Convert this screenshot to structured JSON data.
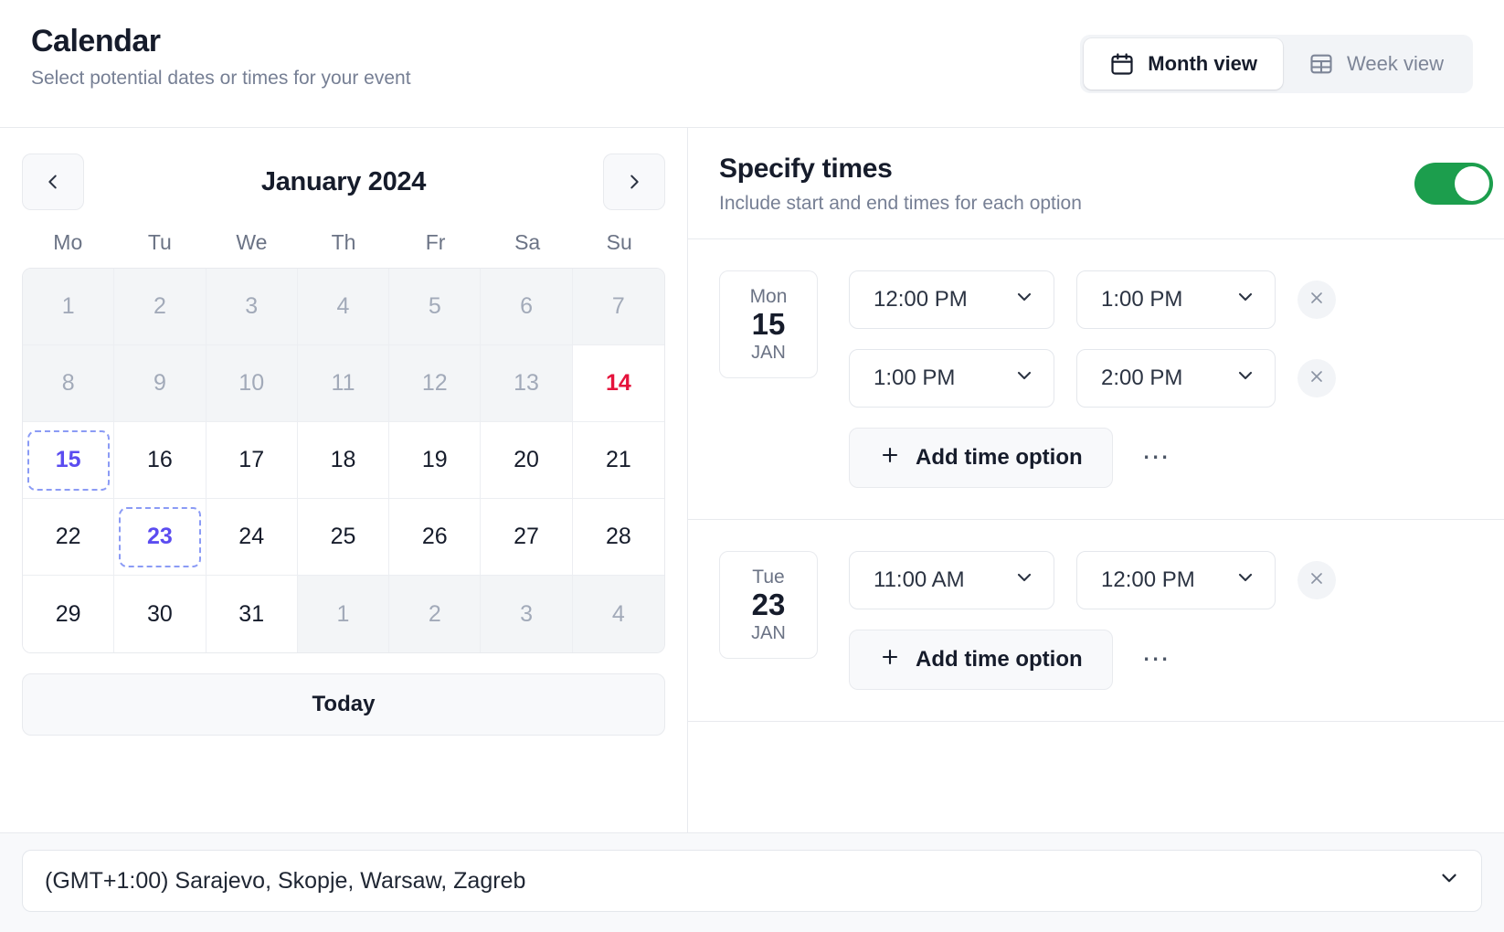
{
  "header": {
    "title": "Calendar",
    "subtitle": "Select potential dates or times for your event",
    "views": [
      {
        "label": "Month view",
        "icon": "calendar-icon",
        "active": true
      },
      {
        "label": "Week view",
        "icon": "table-grid-icon",
        "active": false
      }
    ]
  },
  "calendar": {
    "month_label": "January 2024",
    "prev_icon": "chevron-left-icon",
    "next_icon": "chevron-right-icon",
    "weekdays": [
      "Mo",
      "Tu",
      "We",
      "Th",
      "Fr",
      "Sa",
      "Su"
    ],
    "today_button": "Today",
    "colors": {
      "selected": "#5b4cf0",
      "selected_border": "#8b9bf5",
      "today": "#e5133c",
      "muted": "#a2aab9"
    },
    "weeks": [
      [
        {
          "day": "1",
          "state": "muted"
        },
        {
          "day": "2",
          "state": "muted"
        },
        {
          "day": "3",
          "state": "muted"
        },
        {
          "day": "4",
          "state": "muted"
        },
        {
          "day": "5",
          "state": "muted"
        },
        {
          "day": "6",
          "state": "muted"
        },
        {
          "day": "7",
          "state": "muted"
        }
      ],
      [
        {
          "day": "8",
          "state": "muted"
        },
        {
          "day": "9",
          "state": "muted"
        },
        {
          "day": "10",
          "state": "muted"
        },
        {
          "day": "11",
          "state": "muted"
        },
        {
          "day": "12",
          "state": "muted"
        },
        {
          "day": "13",
          "state": "muted"
        },
        {
          "day": "14",
          "state": "today"
        }
      ],
      [
        {
          "day": "15",
          "state": "selected"
        },
        {
          "day": "16",
          "state": "normal"
        },
        {
          "day": "17",
          "state": "normal"
        },
        {
          "day": "18",
          "state": "normal"
        },
        {
          "day": "19",
          "state": "normal"
        },
        {
          "day": "20",
          "state": "normal"
        },
        {
          "day": "21",
          "state": "normal"
        }
      ],
      [
        {
          "day": "22",
          "state": "normal"
        },
        {
          "day": "23",
          "state": "selected"
        },
        {
          "day": "24",
          "state": "normal"
        },
        {
          "day": "25",
          "state": "normal"
        },
        {
          "day": "26",
          "state": "normal"
        },
        {
          "day": "27",
          "state": "normal"
        },
        {
          "day": "28",
          "state": "normal"
        }
      ],
      [
        {
          "day": "29",
          "state": "normal"
        },
        {
          "day": "30",
          "state": "normal"
        },
        {
          "day": "31",
          "state": "normal"
        },
        {
          "day": "1",
          "state": "muted"
        },
        {
          "day": "2",
          "state": "muted"
        },
        {
          "day": "3",
          "state": "muted"
        },
        {
          "day": "4",
          "state": "muted"
        }
      ]
    ]
  },
  "times": {
    "title": "Specify times",
    "subtitle": "Include start and end times for each option",
    "toggle_on": true,
    "toggle_color": "#1c9e4d",
    "add_label": "Add time option",
    "add_icon": "plus-icon",
    "more_icon": "ellipsis-icon",
    "remove_icon": "close-icon",
    "chevron_icon": "chevron-down-icon",
    "days": [
      {
        "weekday": "Mon",
        "day": "15",
        "month": "JAN",
        "slots": [
          {
            "start": "12:00 PM",
            "end": "1:00 PM"
          },
          {
            "start": "1:00 PM",
            "end": "2:00 PM"
          }
        ]
      },
      {
        "weekday": "Tue",
        "day": "23",
        "month": "JAN",
        "slots": [
          {
            "start": "11:00 AM",
            "end": "12:00 PM"
          }
        ]
      }
    ]
  },
  "footer": {
    "timezone": "(GMT+1:00) Sarajevo, Skopje, Warsaw, Zagreb",
    "chevron_icon": "chevron-down-icon"
  }
}
